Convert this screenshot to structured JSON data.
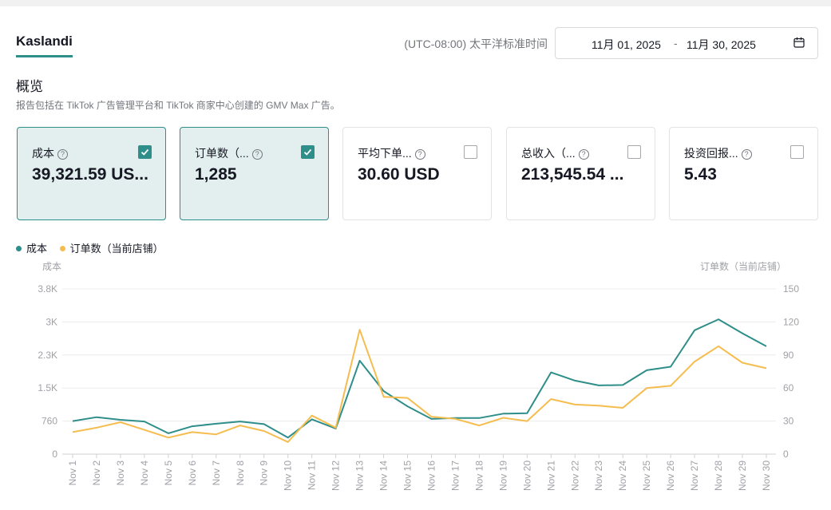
{
  "header": {
    "tab_label": "Kaslandi",
    "timezone": "(UTC-08:00) 太平洋标准时间",
    "date_start": "11月 01, 2025",
    "date_separator": "-",
    "date_end": "11月 30, 2025",
    "calendar_icon": "calendar-icon"
  },
  "overview": {
    "title": "概览",
    "description": "报告包括在 TikTok 广告管理平台和 TikTok 商家中心创建的 GMV Max 广告。"
  },
  "metrics": [
    {
      "label": "成本",
      "value": "39,321.59 US...",
      "checked": true
    },
    {
      "label": "订单数（...",
      "value": "1,285",
      "checked": true
    },
    {
      "label": "平均下单...",
      "value": "30.60 USD",
      "checked": false
    },
    {
      "label": "总收入（...",
      "value": "213,545.54 ...",
      "checked": false
    },
    {
      "label": "投资回报...",
      "value": "5.43",
      "checked": false
    }
  ],
  "help_icon": "?",
  "legend": {
    "series1": "成本",
    "series2": "订单数（当前店铺）"
  },
  "axis_titles": {
    "left": "成本",
    "right": "订单数（当前店铺）"
  },
  "colors": {
    "accent": "#2e8e8a",
    "cost_line": "#2e8e8a",
    "orders_line": "#f5bd4f"
  },
  "chart_data": {
    "type": "line",
    "x": [
      "Nov 1",
      "Nov 2",
      "Nov 3",
      "Nov 4",
      "Nov 5",
      "Nov 6",
      "Nov 7",
      "Nov 8",
      "Nov 9",
      "Nov 10",
      "Nov 11",
      "Nov 12",
      "Nov 13",
      "Nov 14",
      "Nov 15",
      "Nov 16",
      "Nov 17",
      "Nov 18",
      "Nov 19",
      "Nov 20",
      "Nov 21",
      "Nov 22",
      "Nov 23",
      "Nov 24",
      "Nov 25",
      "Nov 26",
      "Nov 27",
      "Nov 28",
      "Nov 29",
      "Nov 30"
    ],
    "series": [
      {
        "name": "成本",
        "axis": "left",
        "values": [
          760,
          850,
          790,
          750,
          480,
          640,
          700,
          750,
          690,
          380,
          800,
          590,
          2150,
          1450,
          1100,
          810,
          830,
          830,
          930,
          940,
          1880,
          1690,
          1580,
          1590,
          1930,
          2010,
          2850,
          3100,
          2780,
          2480
        ]
      },
      {
        "name": "订单数（当前店铺）",
        "axis": "right",
        "values": [
          20,
          24,
          29,
          22,
          15,
          20,
          18,
          26,
          21,
          11,
          35,
          24,
          113,
          52,
          51,
          34,
          32,
          26,
          33,
          30,
          50,
          45,
          44,
          42,
          60,
          62,
          84,
          98,
          83,
          78
        ]
      }
    ],
    "y_left": {
      "ticks": [
        "0",
        "760",
        "1.5K",
        "2.3K",
        "3K",
        "3.8K"
      ],
      "range": [
        0,
        3800
      ]
    },
    "y_right": {
      "ticks": [
        "0",
        "30",
        "60",
        "90",
        "120",
        "150"
      ],
      "range": [
        0,
        150
      ]
    },
    "grid": true,
    "legend_position": "top-left"
  }
}
